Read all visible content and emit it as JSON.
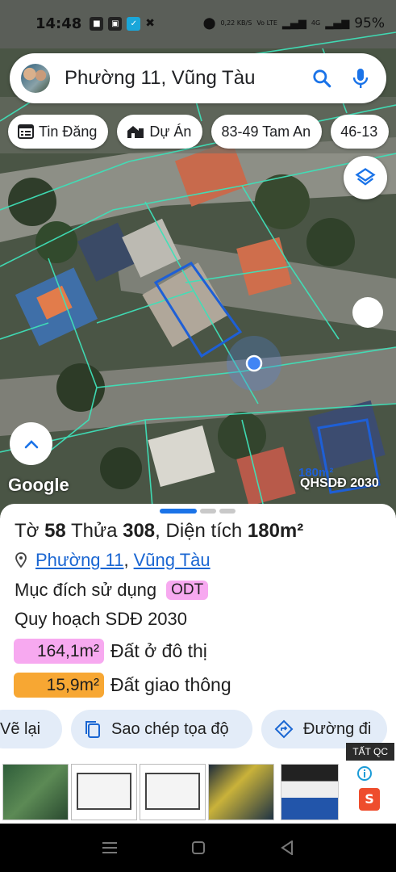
{
  "status_bar": {
    "time": "14:48",
    "net_speed": "0,22 KB/S",
    "net_type": "Vo LTE",
    "signal": "4G",
    "battery": "95%"
  },
  "search": {
    "query": "Phường 11, Vũng Tàu"
  },
  "chips": [
    {
      "label": "Tin Đăng",
      "icon": "listing-icon"
    },
    {
      "label": "Dự Án",
      "icon": "buildings-icon"
    },
    {
      "label": "83-49 Tam An"
    },
    {
      "label": "46-13"
    }
  ],
  "map": {
    "attribution": "Google",
    "plan_label": "QHSDĐ 2030",
    "partial_area_label": "180m²"
  },
  "parcel": {
    "title_prefix": "Tờ",
    "sheet_no": "58",
    "parcel_prefix": "Thửa",
    "parcel_no": "308",
    "area_prefix": ", Diện tích",
    "area": "180m²",
    "ward": "Phường 11",
    "city": "Vũng Tàu",
    "purpose_label": "Mục đích sử dụng",
    "purpose_code": "ODT",
    "plan_label": "Quy hoạch SDĐ 2030",
    "land_uses": [
      {
        "amount": "164,1m²",
        "label": "Đất ở đô thị",
        "color": "#f7a9f0"
      },
      {
        "amount": "15,9m²",
        "label": "Đất giao thông",
        "color": "#f7a733"
      }
    ]
  },
  "actions": {
    "redraw": "Vẽ lại",
    "copy_coords": "Sao chép tọa độ",
    "directions": "Đường đi"
  },
  "ad": {
    "tag": "TẤT QC"
  },
  "colors": {
    "accent_blue": "#1a73e8",
    "link_blue": "#1a66d2",
    "parcel_outline": "#1e5fd6",
    "cadastral_lines": "#3fe0b8"
  }
}
